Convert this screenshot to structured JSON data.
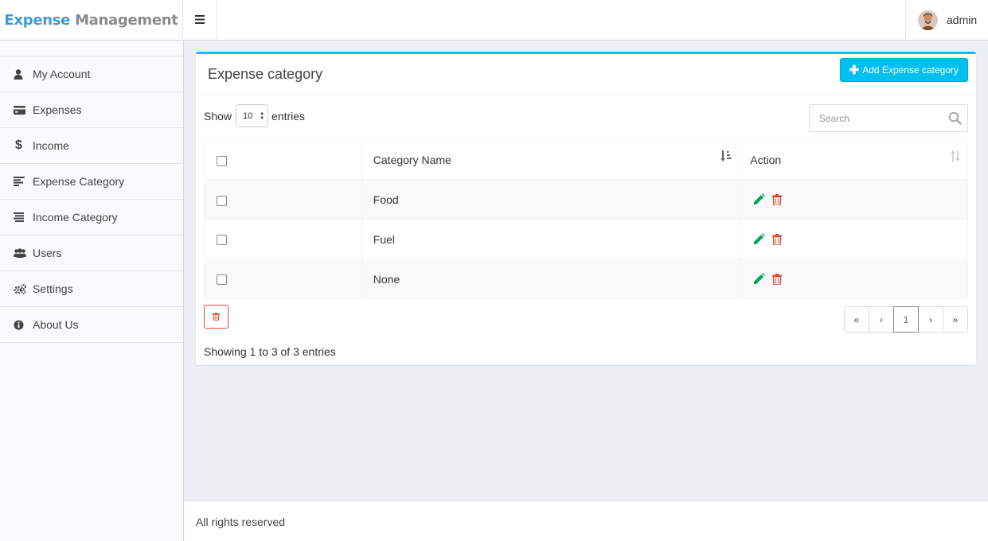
{
  "app": {
    "logo_part1": "Expense",
    "logo_part2": "Management",
    "user_name": "admin"
  },
  "sidebar": {
    "items": [
      {
        "label": "My Account",
        "icon": "user-icon"
      },
      {
        "label": "Expenses",
        "icon": "credit-card-icon"
      },
      {
        "label": "Income",
        "icon": "dollar-icon"
      },
      {
        "label": "Expense Category",
        "icon": "align-left-icon"
      },
      {
        "label": "Income Category",
        "icon": "align-justify-icon"
      },
      {
        "label": "Users",
        "icon": "users-icon"
      },
      {
        "label": "Settings",
        "icon": "cogs-icon"
      },
      {
        "label": "About Us",
        "icon": "info-circle-icon"
      }
    ]
  },
  "box": {
    "title": "Expense category",
    "add_button": "Add Expense category",
    "show_label": "Show",
    "entries_label": "entries",
    "page_length": "10",
    "search_placeholder": "Search",
    "info": "Showing 1 to 3 of 3 entries"
  },
  "table": {
    "headers": [
      "",
      "Category Name",
      "Action"
    ],
    "rows": [
      {
        "name": "Food"
      },
      {
        "name": "Fuel"
      },
      {
        "name": "None"
      }
    ]
  },
  "pagination": {
    "first": "«",
    "prev": "‹",
    "current": "1",
    "next": "›",
    "last": "»"
  },
  "footer": {
    "text": "All rights reserved"
  },
  "colors": {
    "accent": "#00c0ef",
    "edit": "#00a65a",
    "delete": "#dd4b39",
    "logo_blue": "#3c9ad9"
  }
}
